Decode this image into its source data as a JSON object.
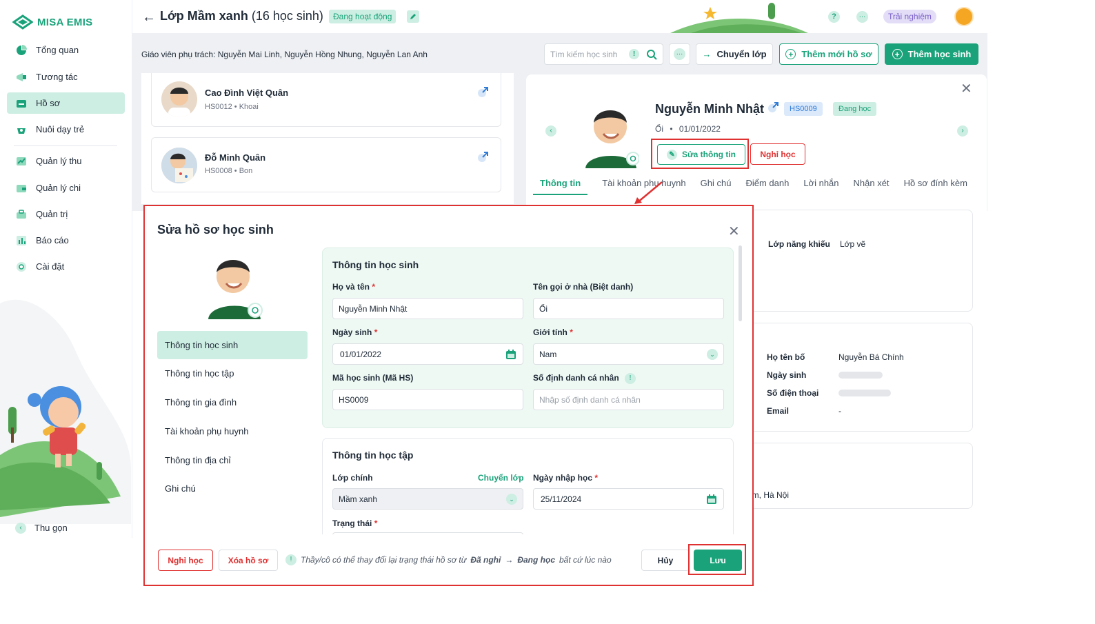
{
  "brand": {
    "name": "MISA EMIS"
  },
  "sidebar": {
    "items": [
      {
        "label": "Tổng quan"
      },
      {
        "label": "Tương tác"
      },
      {
        "label": "Hồ sơ"
      },
      {
        "label": "Nuôi dạy trẻ"
      },
      {
        "label": "Quản lý thu"
      },
      {
        "label": "Quản lý chi"
      },
      {
        "label": "Quản trị"
      },
      {
        "label": "Báo cáo"
      },
      {
        "label": "Cài đặt"
      }
    ],
    "collapse_label": "Thu gọn"
  },
  "header": {
    "title": "Lớp Mầm xanh",
    "count": "(16 học sinh)",
    "status": "Đang hoạt động",
    "help": "?",
    "trial": "Trải nghiệm"
  },
  "subbar": {
    "teachers": "Giáo viên phụ trách: Nguyễn Mai Linh, Nguyễn Hồng Nhung, Nguyễn Lan Anh",
    "search_placeholder": "Tìm kiếm học sinh",
    "transfer_label": "Chuyển lớp",
    "add_profile_label": "Thêm mới hồ sơ",
    "add_student_label": "Thêm học sinh"
  },
  "students": [
    {
      "name": "Cao Đình Việt Quân",
      "meta": "HS0012 • Khoai"
    },
    {
      "name": "Đỗ Minh Quân",
      "meta": "HS0008 • Bon"
    }
  ],
  "detail": {
    "name": "Nguyễn Minh Nhật",
    "code": "HS0009",
    "status": "Đang học",
    "nickname": "Ổi",
    "dob": "01/01/2022",
    "edit_label": "Sửa thông tin",
    "leave_label": "Nghỉ học",
    "tabs": [
      "Thông tin",
      "Tài khoản phụ huynh",
      "Ghi chú",
      "Điểm danh",
      "Lời nhắn",
      "Nhận xét",
      "Hồ sơ đính kèm"
    ],
    "talent_key": "Lớp năng khiếu",
    "talent_value": "Lớp vẽ",
    "father_key": "Họ tên bố",
    "father_value": "Nguyễn Bá Chính",
    "dob_key": "Ngày sinh",
    "phone_key": "Số điện thoại",
    "email_key": "Email",
    "email_value": "-",
    "address_fragment": "ệm, Hà Nội"
  },
  "modal": {
    "title": "Sửa hồ sơ học sinh",
    "menu": [
      "Thông tin học sinh",
      "Thông tin học tập",
      "Thông tin gia đình",
      "Tài khoản phụ huynh",
      "Thông tin địa chỉ",
      "Ghi chú"
    ],
    "section1_title": "Thông tin học sinh",
    "fullname_label": "Họ và tên",
    "fullname_value": "Nguyễn Minh Nhật",
    "nickname_label": "Tên gọi ở nhà (Biệt danh)",
    "nickname_value": "Ổi",
    "dob_label": "Ngày sinh",
    "dob_value": "01/01/2022",
    "gender_label": "Giới tính",
    "gender_value": "Nam",
    "code_label": "Mã học sinh (Mã HS)",
    "code_value": "HS0009",
    "idnum_label": "Số định danh cá nhân",
    "idnum_placeholder": "Nhập số định danh cá nhân",
    "section2_title": "Thông tin học tập",
    "class_label": "Lớp chính",
    "class_transfer": "Chuyển lớp",
    "class_value": "Mầm xanh",
    "enroll_label": "Ngày nhập học",
    "enroll_value": "25/11/2024",
    "status_label": "Trạng thái",
    "btn_leave": "Nghỉ học",
    "btn_delete": "Xóa hồ sơ",
    "note_prefix": "Thầy/cô có thể thay đổi lại trạng thái hồ sơ từ",
    "note_from": "Đã nghỉ",
    "note_arrow": "→",
    "note_to": "Đang học",
    "note_suffix": "bất cứ lúc nào",
    "btn_cancel": "Hủy",
    "btn_save": "Lưu",
    "required_mark": "*"
  },
  "colors": {
    "accent": "#1aa37a",
    "accent_light": "#cdeee2",
    "danger": "#e03131"
  }
}
